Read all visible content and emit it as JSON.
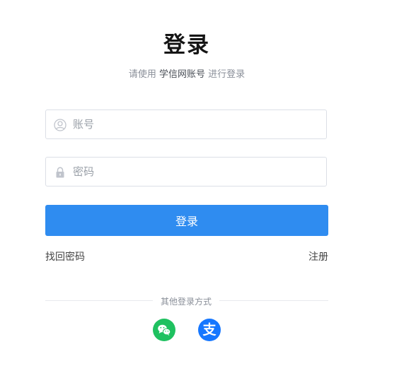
{
  "header": {
    "title": "登录",
    "subtitle_prefix": "请使用 ",
    "subtitle_account": "学信网账号",
    "subtitle_suffix": " 进行登录"
  },
  "form": {
    "username": {
      "value": "",
      "placeholder": "账号",
      "icon": "user-icon"
    },
    "password": {
      "value": "",
      "placeholder": "密码",
      "icon": "lock-icon"
    },
    "login_label": "登录",
    "accent_color": "#2f8cf0"
  },
  "links": {
    "forgot_password": "找回密码",
    "register": "注册"
  },
  "other_login": {
    "label": "其他登录方式",
    "providers": [
      {
        "name": "wechat",
        "icon": "wechat-icon",
        "color": "#1fc160"
      },
      {
        "name": "alipay",
        "icon": "alipay-icon",
        "glyph": "支",
        "color": "#1677ff"
      }
    ]
  }
}
